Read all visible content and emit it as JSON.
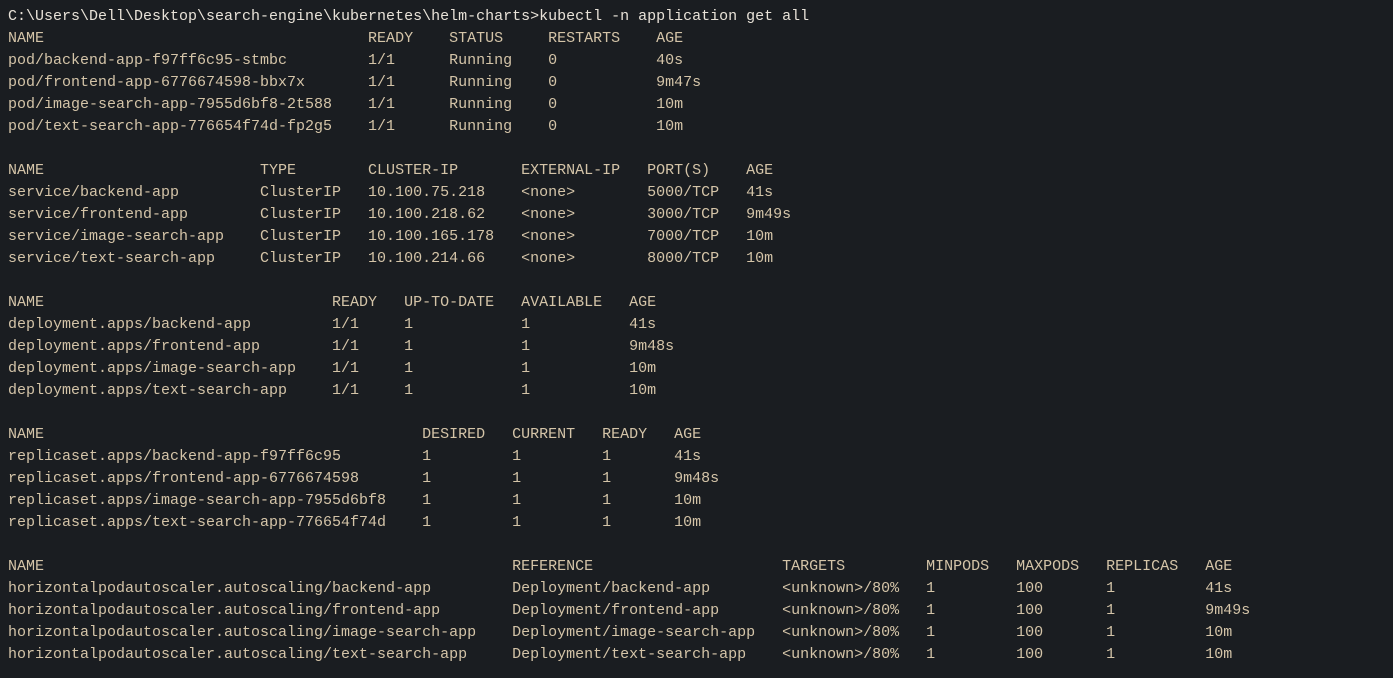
{
  "prompt": "C:\\Users\\Dell\\Desktop\\search-engine\\kubernetes\\helm-charts>",
  "command": "kubectl -n application get all",
  "section_spacer": "",
  "pods": {
    "headers": [
      "NAME",
      "READY",
      "STATUS",
      "RESTARTS",
      "AGE"
    ],
    "rows": [
      [
        "pod/backend-app-f97ff6c95-stmbc",
        "1/1",
        "Running",
        "0",
        "40s"
      ],
      [
        "pod/frontend-app-6776674598-bbx7x",
        "1/1",
        "Running",
        "0",
        "9m47s"
      ],
      [
        "pod/image-search-app-7955d6bf8-2t588",
        "1/1",
        "Running",
        "0",
        "10m"
      ],
      [
        "pod/text-search-app-776654f74d-fp2g5",
        "1/1",
        "Running",
        "0",
        "10m"
      ]
    ],
    "cols": [
      40,
      9,
      11,
      12,
      0
    ]
  },
  "services": {
    "headers": [
      "NAME",
      "TYPE",
      "CLUSTER-IP",
      "EXTERNAL-IP",
      "PORT(S)",
      "AGE"
    ],
    "rows": [
      [
        "service/backend-app",
        "ClusterIP",
        "10.100.75.218",
        "<none>",
        "5000/TCP",
        "41s"
      ],
      [
        "service/frontend-app",
        "ClusterIP",
        "10.100.218.62",
        "<none>",
        "3000/TCP",
        "9m49s"
      ],
      [
        "service/image-search-app",
        "ClusterIP",
        "10.100.165.178",
        "<none>",
        "7000/TCP",
        "10m"
      ],
      [
        "service/text-search-app",
        "ClusterIP",
        "10.100.214.66",
        "<none>",
        "8000/TCP",
        "10m"
      ]
    ],
    "cols": [
      28,
      12,
      17,
      14,
      11,
      0
    ]
  },
  "deployments": {
    "headers": [
      "NAME",
      "READY",
      "UP-TO-DATE",
      "AVAILABLE",
      "AGE"
    ],
    "rows": [
      [
        "deployment.apps/backend-app",
        "1/1",
        "1",
        "1",
        "41s"
      ],
      [
        "deployment.apps/frontend-app",
        "1/1",
        "1",
        "1",
        "9m48s"
      ],
      [
        "deployment.apps/image-search-app",
        "1/1",
        "1",
        "1",
        "10m"
      ],
      [
        "deployment.apps/text-search-app",
        "1/1",
        "1",
        "1",
        "10m"
      ]
    ],
    "cols": [
      36,
      8,
      13,
      12,
      0
    ]
  },
  "replicasets": {
    "headers": [
      "NAME",
      "DESIRED",
      "CURRENT",
      "READY",
      "AGE"
    ],
    "rows": [
      [
        "replicaset.apps/backend-app-f97ff6c95",
        "1",
        "1",
        "1",
        "41s"
      ],
      [
        "replicaset.apps/frontend-app-6776674598",
        "1",
        "1",
        "1",
        "9m48s"
      ],
      [
        "replicaset.apps/image-search-app-7955d6bf8",
        "1",
        "1",
        "1",
        "10m"
      ],
      [
        "replicaset.apps/text-search-app-776654f74d",
        "1",
        "1",
        "1",
        "10m"
      ]
    ],
    "cols": [
      46,
      10,
      10,
      8,
      0
    ]
  },
  "hpas": {
    "headers": [
      "NAME",
      "REFERENCE",
      "TARGETS",
      "MINPODS",
      "MAXPODS",
      "REPLICAS",
      "AGE"
    ],
    "rows": [
      [
        "horizontalpodautoscaler.autoscaling/backend-app",
        "Deployment/backend-app",
        "<unknown>/80%",
        "1",
        "100",
        "1",
        "41s"
      ],
      [
        "horizontalpodautoscaler.autoscaling/frontend-app",
        "Deployment/frontend-app",
        "<unknown>/80%",
        "1",
        "100",
        "1",
        "9m49s"
      ],
      [
        "horizontalpodautoscaler.autoscaling/image-search-app",
        "Deployment/image-search-app",
        "<unknown>/80%",
        "1",
        "100",
        "1",
        "10m"
      ],
      [
        "horizontalpodautoscaler.autoscaling/text-search-app",
        "Deployment/text-search-app",
        "<unknown>/80%",
        "1",
        "100",
        "1",
        "10m"
      ]
    ],
    "cols": [
      56,
      30,
      16,
      10,
      10,
      11,
      0
    ]
  }
}
